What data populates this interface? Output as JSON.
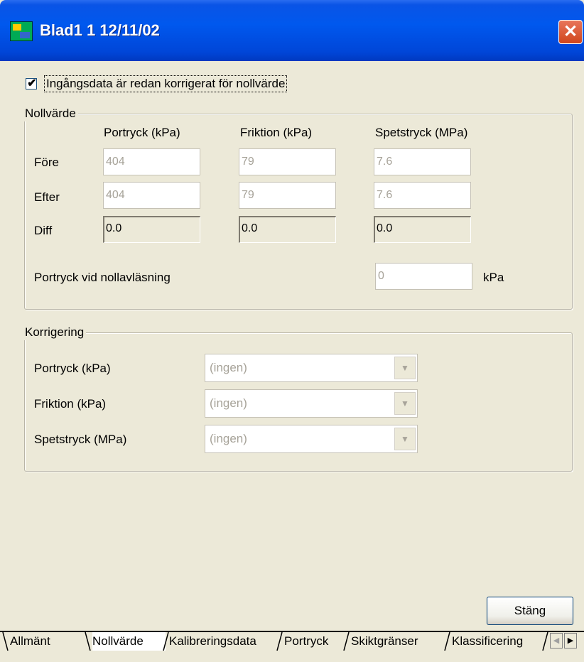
{
  "window": {
    "title": "Blad1  1 12/11/02"
  },
  "checkbox": {
    "label": "Ingångsdata är redan korrigerat för nollvärde",
    "mark": "✔"
  },
  "nollvarde": {
    "legend": "Nollvärde",
    "columns": [
      "Portryck (kPa)",
      "Friktion (kPa)",
      "Spetstryck (MPa)"
    ],
    "rows": [
      {
        "label": "Före",
        "values": [
          "404",
          "79",
          "7.6"
        ]
      },
      {
        "label": "Efter",
        "values": [
          "404",
          "79",
          "7.6"
        ]
      },
      {
        "label": "Diff",
        "values": [
          "0.0",
          "0.0",
          "0.0"
        ]
      }
    ],
    "portryck_label": "Portryck vid nollavläsning",
    "portryck_value": "0",
    "portryck_unit": "kPa"
  },
  "korrigering": {
    "legend": "Korrigering",
    "rows": [
      {
        "label": "Portryck (kPa)",
        "value": "(ingen)"
      },
      {
        "label": "Friktion (kPa)",
        "value": "(ingen)"
      },
      {
        "label": "Spetstryck (MPa)",
        "value": "(ingen)"
      }
    ]
  },
  "buttons": {
    "close": "Stäng"
  },
  "tabs": [
    "Allmänt",
    "Nollvärde",
    "Kalibreringsdata",
    "Portryck",
    "Skiktgränser",
    "Klassificering"
  ],
  "active_tab": "Nollvärde",
  "colors": {
    "titlebar": "#0058EE",
    "close_button": "#D0461C",
    "face": "#ECE9D8",
    "disabled_text": "#A7A399"
  }
}
